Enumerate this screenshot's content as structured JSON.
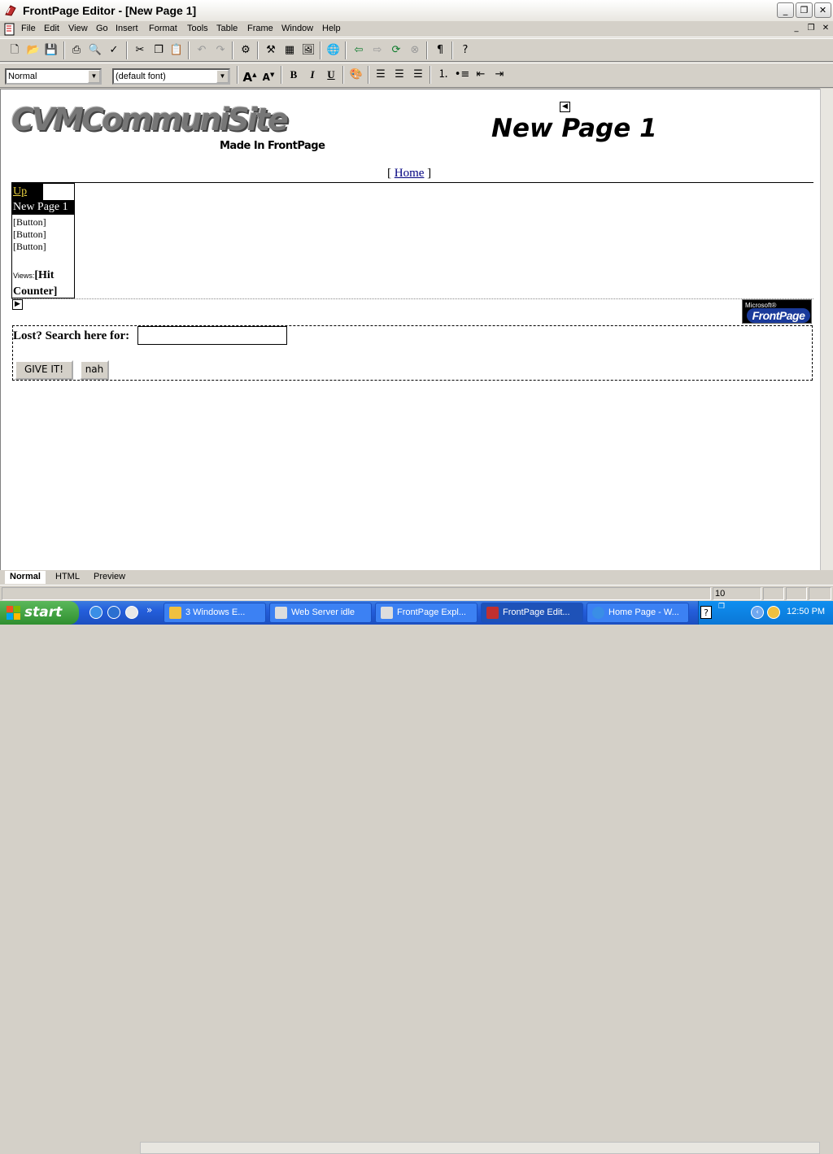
{
  "window": {
    "title": "FrontPage Editor - [New Page 1]",
    "min_label": "_",
    "max_label": "❐",
    "close_label": "✕"
  },
  "menu": [
    "File",
    "Edit",
    "View",
    "Go",
    "Insert",
    "Format",
    "Tools",
    "Table",
    "Frame",
    "Window",
    "Help"
  ],
  "toolbar": {
    "style_combo": "Normal",
    "font_combo": "(default font)",
    "bold": "B",
    "italic": "I",
    "underline": "U",
    "paragraph": "¶"
  },
  "page": {
    "logo": "CVMCommuniSite",
    "made_in": "Made In FrontPage",
    "heading": "New Page 1",
    "home_nav_open": "[ ",
    "home_link": "Home",
    "home_nav_close": " ]",
    "nav": {
      "up": "Up",
      "current": "New Page 1",
      "buttons": [
        "[Button]",
        "[Button]",
        "[Button]"
      ],
      "views_label": "Views:",
      "hit_counter": "[Hit Counter]"
    },
    "fp_badge": {
      "microsoft": "Microsoft®",
      "frontpage": "FrontPage"
    },
    "search": {
      "label": "Lost? Search here for:",
      "value": "",
      "submit": "GIVE IT!",
      "reset": "nah"
    }
  },
  "tabs": [
    "Normal",
    "HTML",
    "Preview"
  ],
  "status": {
    "time": "10 seconds"
  },
  "taskbar": {
    "start": "start",
    "tasks": [
      {
        "label": "3 Windows E...",
        "icon": "folder-icon"
      },
      {
        "label": "Web Server idle",
        "icon": "web-server-icon"
      },
      {
        "label": "FrontPage Expl...",
        "icon": "frontpage-explorer-icon"
      },
      {
        "label": "FrontPage Edit...",
        "icon": "frontpage-editor-icon"
      },
      {
        "label": "Home Page - W...",
        "icon": "internet-explorer-icon"
      }
    ],
    "clock": "12:50 PM"
  },
  "colors": {
    "taskbar": "#245edb",
    "start": "#2f8f2f",
    "nav_up_text": "#e8d040",
    "link": "#000080"
  }
}
